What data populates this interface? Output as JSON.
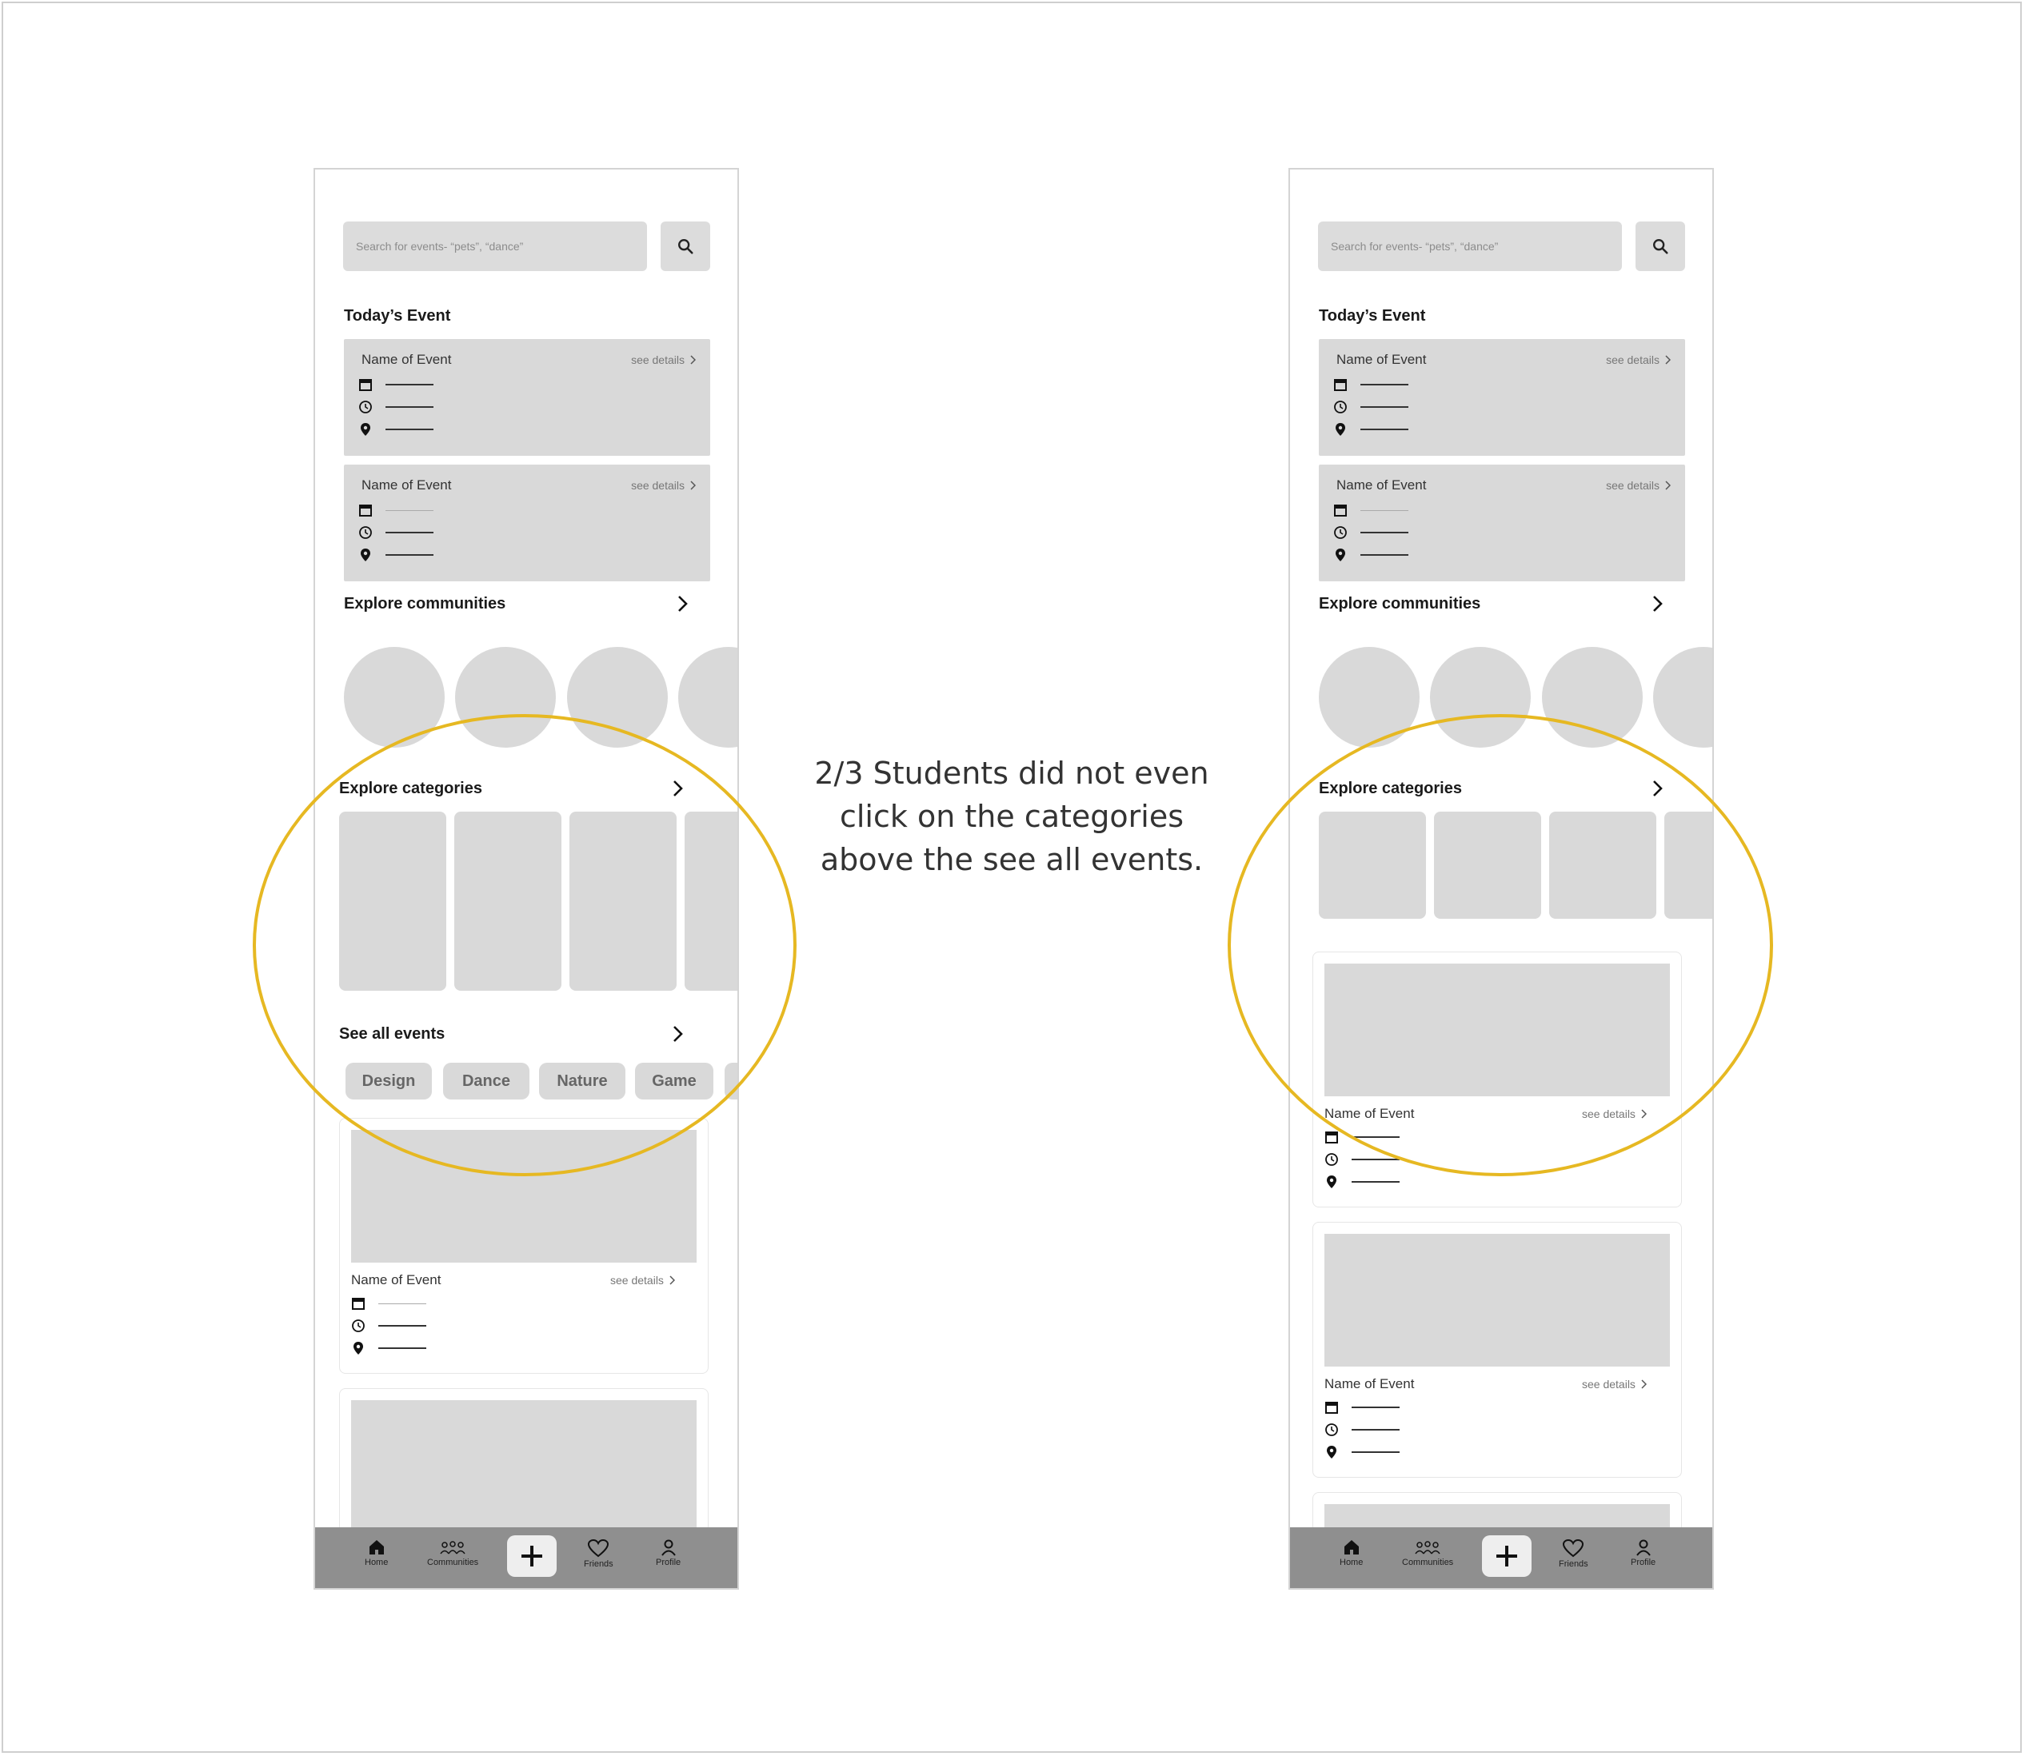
{
  "note": {
    "lines": [
      "2/3 Students did not even",
      "click on the categories",
      "above the see all events."
    ]
  },
  "colors": {
    "highlight": "#e6b822",
    "placeholder_gray": "#d9d9d9",
    "navbar": "#8f8f8f"
  },
  "screen": {
    "search_placeholder": "Search for events- “pets”, “dance”",
    "todays_event_title": "Today’s Event",
    "event_name": "Name of Event",
    "see_details": "see details",
    "explore_communities": "Explore communities",
    "explore_categories": "Explore categories",
    "see_all_events": "See all events",
    "chips": [
      "Design",
      "Dance",
      "Nature",
      "Game"
    ],
    "nav": {
      "home": "Home",
      "communities": "Communities",
      "friends": "Friends",
      "profile": "Profile"
    }
  },
  "icons": {
    "search": "search-icon",
    "calendar": "calendar-icon",
    "clock": "clock-icon",
    "location": "location-pin-icon",
    "chevron": "chevron-right-icon",
    "home": "home-icon",
    "communities": "people-group-icon",
    "add": "plus-icon",
    "friends": "heart-icon",
    "profile": "person-icon"
  }
}
